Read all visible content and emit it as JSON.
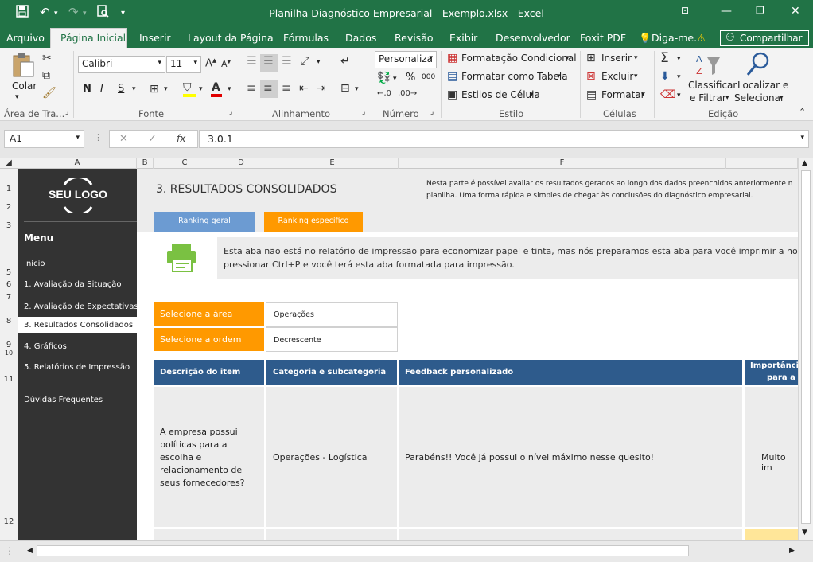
{
  "title_bar": {
    "title": "Planilha Diagnóstico Empresarial - Exemplo.xlsx - Excel",
    "save_icon": "save-icon",
    "undo_icon": "undo-icon",
    "redo_icon": "redo-icon",
    "print_preview_icon": "print-preview-icon"
  },
  "ribbon_tabs": {
    "file": "Arquivo",
    "home": "Página Inicial",
    "insert": "Inserir",
    "layout": "Layout da Página",
    "formulas": "Fórmulas",
    "data": "Dados",
    "review": "Revisão",
    "view": "Exibir",
    "developer": "Desenvolvedor",
    "foxit": "Foxit PDF",
    "tell_me": "Diga-me...",
    "share": "Compartilhar"
  },
  "ribbon": {
    "paste_label": "Colar",
    "font_name": "Calibri",
    "font_size": "11",
    "bold": "N",
    "italic": "I",
    "underline": "S",
    "number_format": "Personaliza",
    "percent": "%",
    "thousands": "000",
    "conditional_formatting": "Formatação Condicional",
    "format_as_table": "Formatar como Tabela",
    "cell_styles": "Estilos de Célula",
    "insert_cells": "Inserir",
    "delete_cells": "Excluir",
    "format_cells": "Formatar",
    "sort_filter_1": "Classificar",
    "sort_filter_2": "e Filtrar",
    "find_select_1": "Localizar e",
    "find_select_2": "Selecionar",
    "groups": {
      "clipboard": "Área de Tra...",
      "font": "Fonte",
      "alignment": "Alinhamento",
      "number": "Número",
      "styles": "Estilo",
      "cells": "Células",
      "editing": "Edição"
    }
  },
  "formula_bar": {
    "name_box": "A1",
    "fx": "fx",
    "formula": "3.0.1"
  },
  "columns": [
    "A",
    "B",
    "C",
    "D",
    "E",
    "F"
  ],
  "rows": [
    "1",
    "2",
    "3",
    "5",
    "6",
    "7",
    "8",
    "9",
    "10",
    "11",
    "12"
  ],
  "sidebar": {
    "logo": "SEU LOGO",
    "menu_title": "Menu",
    "items": [
      "Início",
      "1. Avaliação da Situação",
      "2. Avaliação de Expectativas",
      "3. Resultados Consolidados",
      "4. Gráficos",
      "5. Relatórios de Impressão",
      "Dúvidas Frequentes"
    ]
  },
  "main": {
    "heading": "3. RESULTADOS CONSOLIDADOS",
    "intro_line1": "Nesta parte é possível avaliar os resultados gerados ao longo dos dados preenchidos anteriormente n",
    "intro_line2": "planilha. Uma forma rápida e simples de chegar às conclusões do diagnóstico empresarial.",
    "tab_general": "Ranking geral",
    "tab_specific": "Ranking específico",
    "print_note_line1": "Esta aba não está no relatório de impressão para economizar papel e tinta, mas nós preparamos esta aba para você imprimir a hor",
    "print_note_line2": "pressionar Ctrl+P e você terá esta aba formatada para impressão.",
    "select_area_label": "Selecione a área",
    "select_area_value": "Operações",
    "select_order_label": "Selecione a ordem",
    "select_order_value": "Decrescente",
    "table": {
      "headers": [
        "Descrição do item",
        "Categoria e subcategoria",
        "Feedback personalizado",
        "Importânci",
        "para a"
      ],
      "row1": {
        "description": [
          "A empresa possui",
          "políticas para a",
          "escolha e",
          "relacionamento de",
          "seus fornecedores?"
        ],
        "category": "Operações - Logística",
        "feedback": "Parabéns!! Você já possui o nível máximo nesse quesito!",
        "importance": "Muito im"
      }
    }
  },
  "colors": {
    "excel_green": "#217346",
    "sidebar_dark": "#333333",
    "header_blue": "#2e5b8c",
    "orange": "#ff9900",
    "tab_blue": "#6c9bd2",
    "print_icon_green": "#7ac142",
    "highlight_yellow": "#ffe699"
  }
}
